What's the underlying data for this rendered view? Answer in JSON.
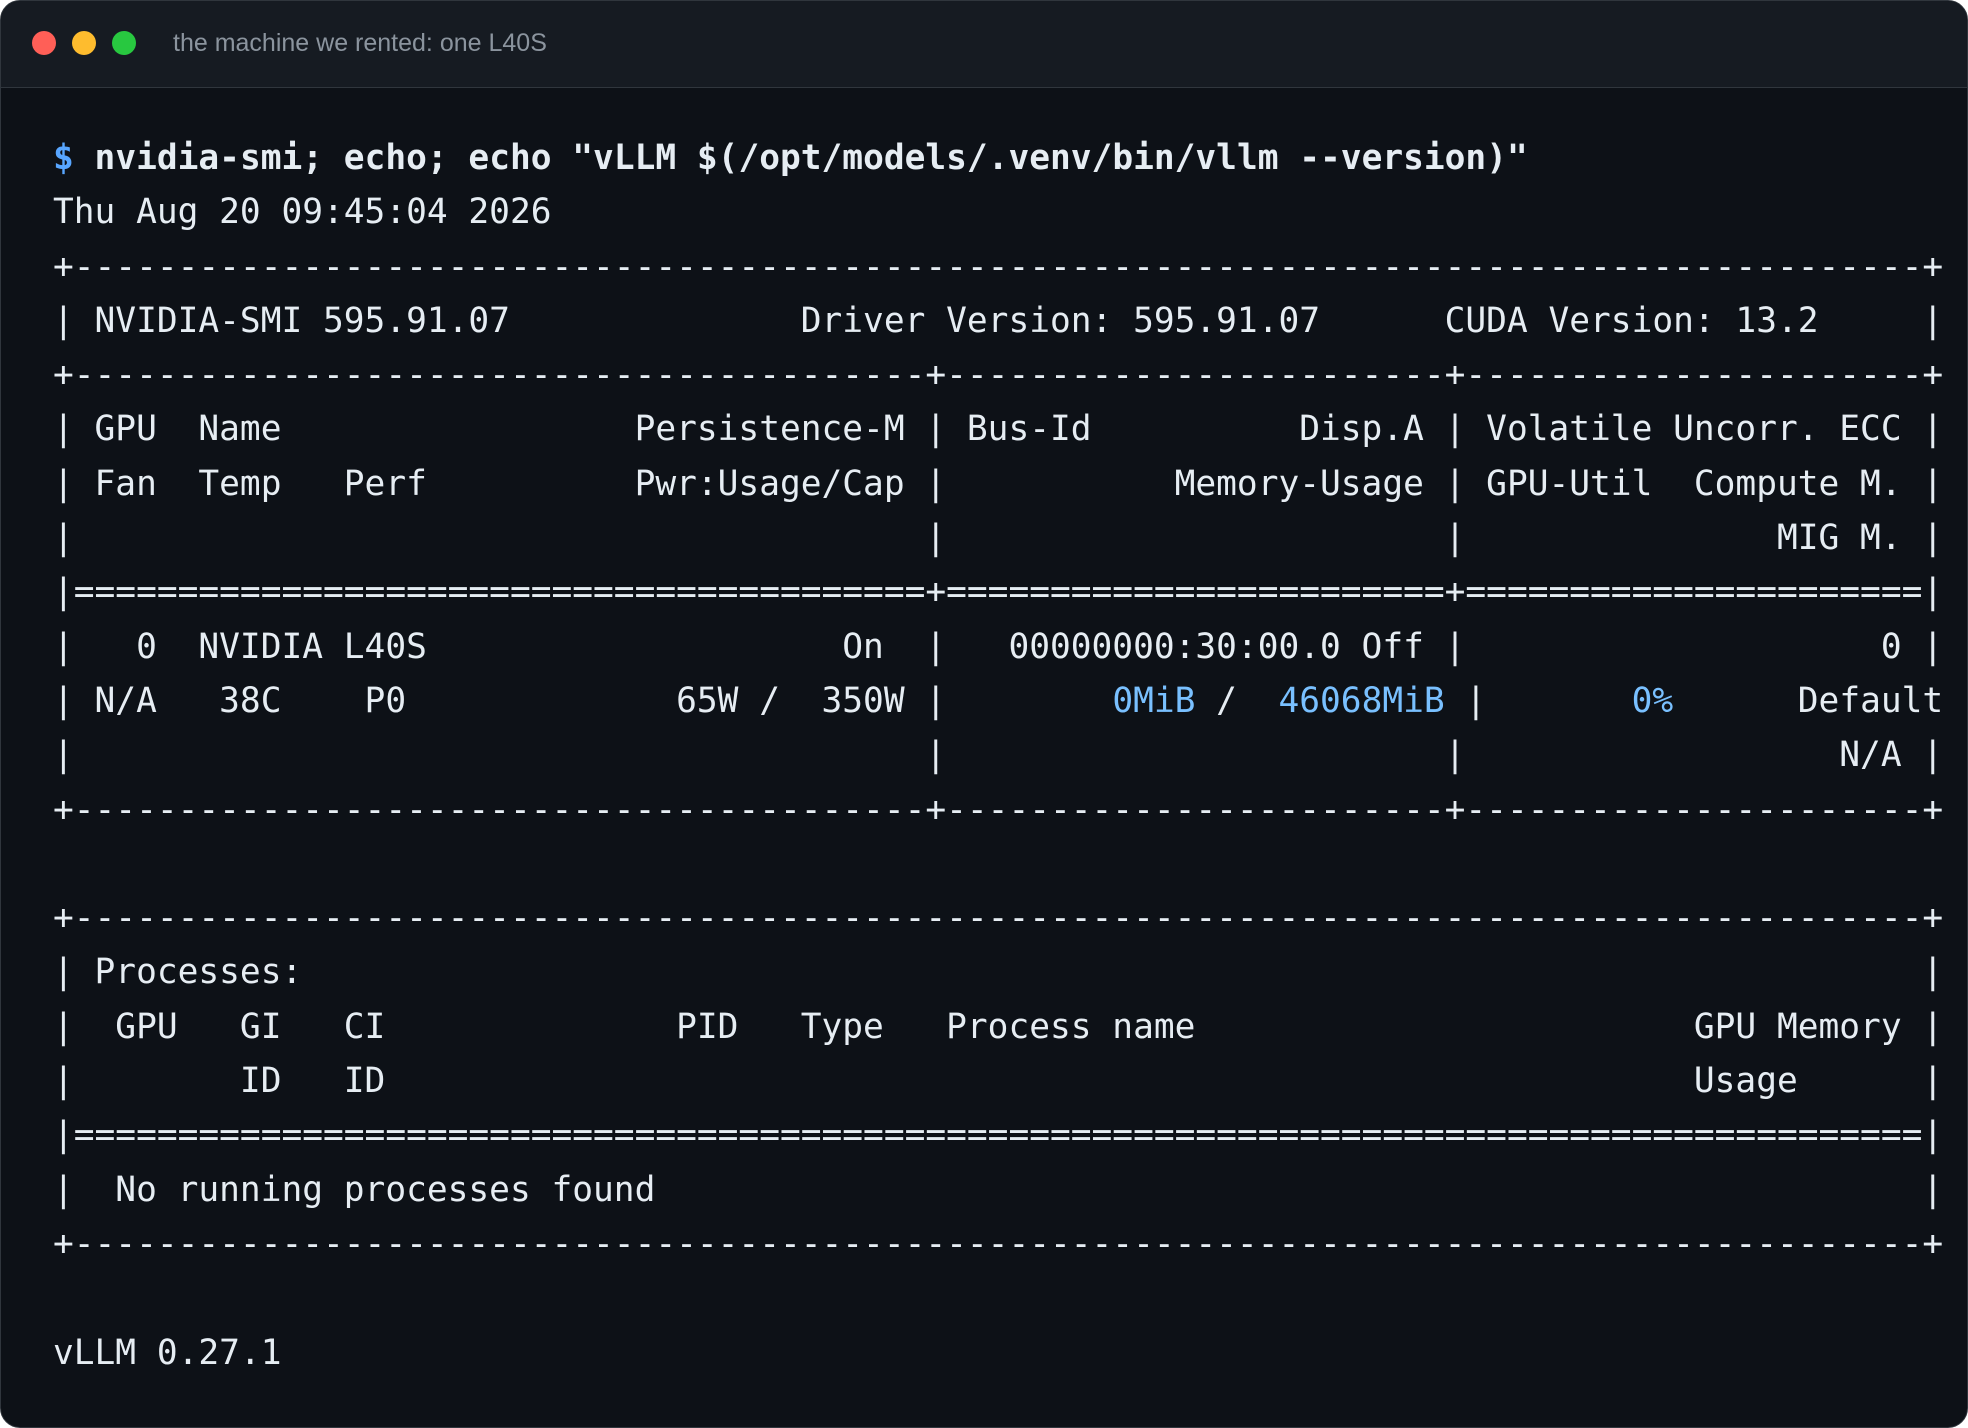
{
  "window": {
    "title": "the machine we rented: one L40S"
  },
  "terminal": {
    "prompt": "$",
    "command": " nvidia-smi; echo; echo \"vLLM $(/opt/models/.venv/bin/vllm --version)\"",
    "date": "Thu Aug 20 09:45:04 2026",
    "smi_border": "+-----------------------------------------------------------------------------------------+",
    "smi_header": "| NVIDIA-SMI 595.91.07              Driver Version: 595.91.07      CUDA Version: 13.2     |",
    "gpu_table_sep": "+-----------------------------------------+------------------------+----------------------+",
    "gpu_table_head_1": "| GPU  Name                 Persistence-M | Bus-Id          Disp.A | Volatile Uncorr. ECC |",
    "gpu_table_head_2": "| Fan  Temp   Perf          Pwr:Usage/Cap |           Memory-Usage | GPU-Util  Compute M. |",
    "gpu_table_head_3": "|                                         |                        |               MIG M. |",
    "gpu_table_eq": "|=========================================+========================+======================|",
    "gpu_row_1": "|   0  NVIDIA L40S                    On  |   00000000:30:00.0 Off |                    0 |",
    "gpu_row_2": {
      "a": "| N/A   38C    P0             65W /  350W |        ",
      "mem_used": "0MiB",
      "b": " /  ",
      "mem_total": "46068MiB",
      "c": " |       ",
      "util": "0%",
      "d": "      Default |"
    },
    "gpu_row_3": "|                                         |                        |                  N/A |",
    "proc_header": "| Processes:                                                                              |",
    "proc_cols_1": "|  GPU   GI   CI              PID   Type   Process name                        GPU Memory |",
    "proc_cols_2": "|        ID   ID                                                               Usage      |",
    "proc_eq": "|=========================================================================================|",
    "proc_none": "|  No running processes found                                                             |",
    "vllm_version": "vLLM 0.27.1"
  },
  "colors": {
    "background": "#0d1117",
    "titlebar": "#161b22",
    "text": "#e6edf3",
    "prompt": "#58a6ff",
    "highlight": "#79c0ff",
    "close": "#ff5f57",
    "minimize": "#febc2e",
    "maximize": "#28c840"
  }
}
